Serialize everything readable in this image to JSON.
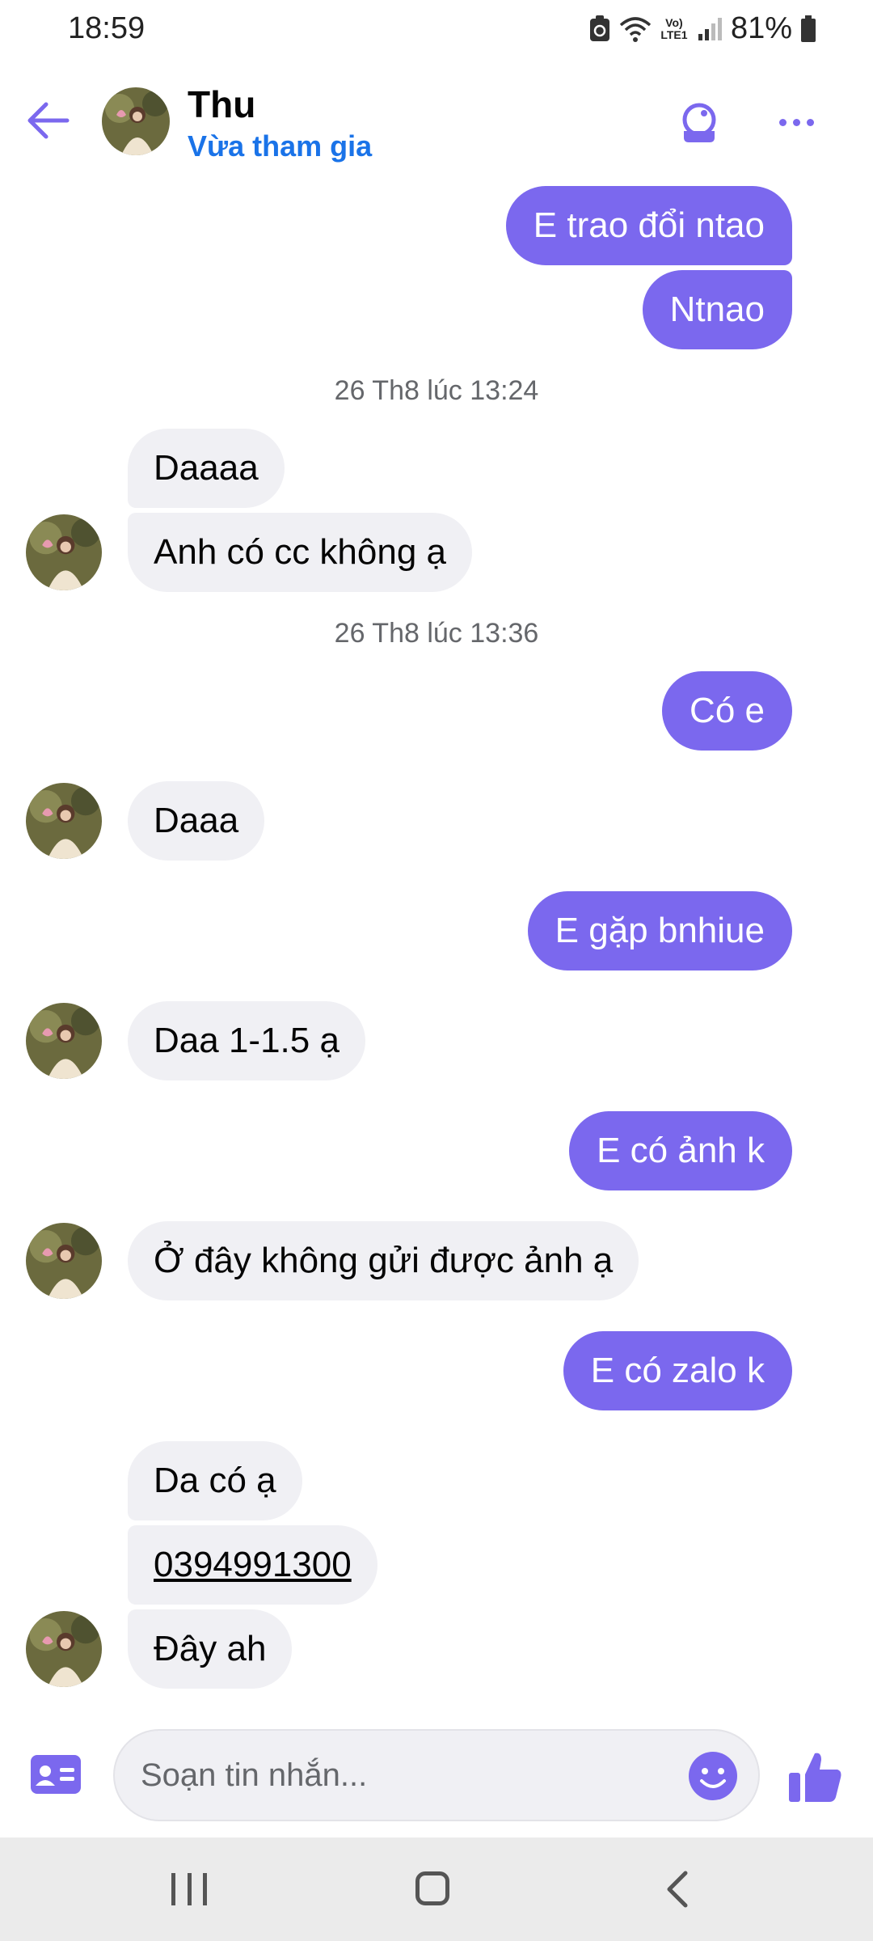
{
  "status_bar": {
    "time": "18:59",
    "battery": "81%",
    "network": "Vo) LTE1"
  },
  "header": {
    "contact_name": "Thu",
    "contact_status": "Vừa tham gia",
    "icons": [
      "back-arrow-icon",
      "audio-call-icon",
      "more-options-icon"
    ],
    "accent_color": "#7b68ee",
    "status_color": "#1a73e8"
  },
  "messages": {
    "sent_1": "E trao đổi ntao",
    "sent_2": "Ntnao",
    "timestamp_1": "26 Th8 lúc 13:24",
    "recv_1": "Daaaa",
    "recv_2": "Anh có cc không ạ",
    "timestamp_2": "26 Th8 lúc 13:36",
    "sent_3": "Có e",
    "recv_3": "Daaa",
    "sent_4": "E gặp bnhiue",
    "recv_4": "Daa 1-1.5 ạ",
    "sent_5": "E có ảnh k",
    "recv_5": "Ở đây không gửi được ảnh ạ",
    "sent_6": "E có zalo k",
    "recv_6": "Da có ạ",
    "recv_7": "0394991300",
    "recv_8": "Đây ah"
  },
  "composer": {
    "placeholder": "Soạn tin nhắn...",
    "icons": [
      "contact-card-icon",
      "emoji-icon",
      "thumbs-up-icon"
    ]
  },
  "nav_bar": {
    "icons": [
      "recents-icon",
      "home-icon",
      "back-icon"
    ]
  },
  "colors": {
    "sent_bubble": "#7b68ee",
    "received_bubble": "#f0f0f4"
  }
}
